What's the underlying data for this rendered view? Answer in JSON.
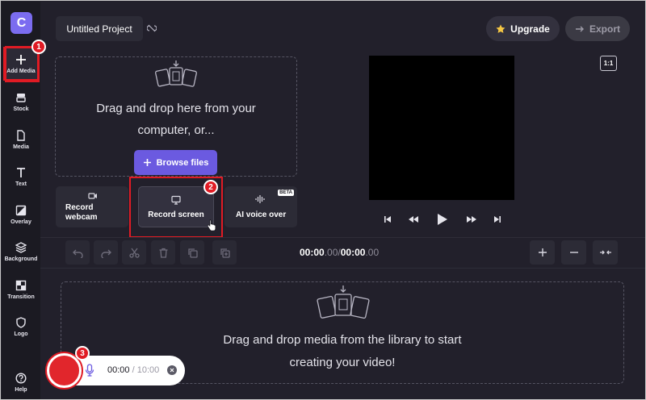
{
  "sidebar": {
    "logo": "C",
    "items": [
      {
        "label": "Add Media",
        "icon": "plus-icon"
      },
      {
        "label": "Stock",
        "icon": "stock-icon"
      },
      {
        "label": "Media",
        "icon": "file-icon"
      },
      {
        "label": "Text",
        "icon": "text-icon"
      },
      {
        "label": "Overlay",
        "icon": "overlay-icon"
      },
      {
        "label": "Background",
        "icon": "layers-icon"
      },
      {
        "label": "Transition",
        "icon": "transition-icon"
      },
      {
        "label": "Logo",
        "icon": "shield-icon"
      },
      {
        "label": "Help",
        "icon": "help-icon"
      }
    ]
  },
  "header": {
    "project_name": "Untitled Project",
    "upgrade_label": "Upgrade",
    "export_label": "Export"
  },
  "media": {
    "drop_text": "Drag and drop here from your computer, or...",
    "browse_label": "Browse files",
    "options": [
      {
        "label": "Record webcam",
        "icon": "webcam-icon"
      },
      {
        "label": "Record screen",
        "icon": "monitor-icon"
      },
      {
        "label": "AI voice over",
        "icon": "waveform-icon",
        "badge": "BETA"
      }
    ]
  },
  "preview": {
    "aspect_ratio": "1:1"
  },
  "timeline": {
    "current_time": "00:00",
    "current_frac": ".00",
    "separator": "/",
    "total_time": "00:00",
    "total_frac": ".00",
    "drop_text": "Drag and drop media from the library to start creating your video!"
  },
  "recorder": {
    "elapsed": "00:00",
    "limit": "/ 10:00"
  },
  "annotations": {
    "step1": "1",
    "step2": "2",
    "step3": "3"
  },
  "colors": {
    "accent": "#6b5ae0",
    "highlight": "#e01b24",
    "background": "#22202b"
  }
}
